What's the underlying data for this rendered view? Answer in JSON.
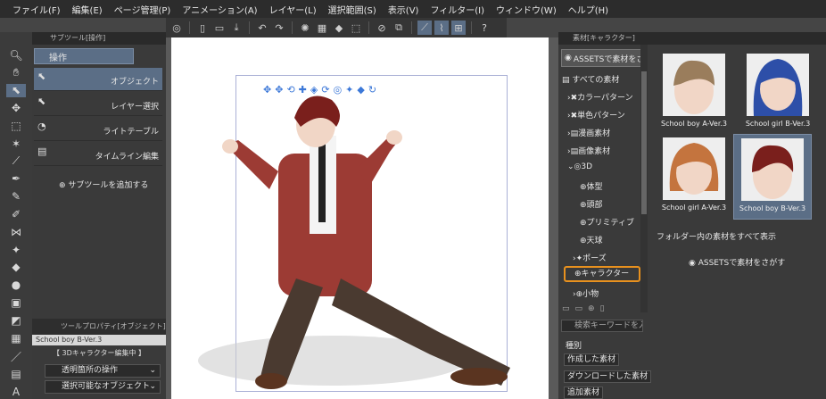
{
  "menubar": [
    "ファイル(F)",
    "編集(E)",
    "ページ管理(P)",
    "アニメーション(A)",
    "レイヤー(L)",
    "選択範囲(S)",
    "表示(V)",
    "フィルター(I)",
    "ウィンドウ(W)",
    "ヘルプ(H)"
  ],
  "subtool_panel": {
    "title": "サブツール[操作]",
    "group": "操作",
    "items": [
      "オブジェクト",
      "レイヤー選択",
      "ライトテーブル",
      "タイムライン編集"
    ],
    "add_label": "サブツールを追加する"
  },
  "tool_property": {
    "title": "ツールプロパティ[オブジェクト]",
    "head": "School boy B-Ver.3",
    "banner": "【 3Dキャラクター編集中 】",
    "dropdowns": [
      "透明箇所の操作",
      "選択可能なオブジェクト"
    ]
  },
  "material_panel": {
    "title": "素材[キャラクター]",
    "assets_button": "ASSETSで素材をさがす",
    "tree": [
      "すべての素材",
      "カラーパターン",
      "単色パターン",
      "漫画素材",
      "画像素材",
      "3D",
      "体型",
      "頭部",
      "プリミティブ",
      "天球",
      "ポーズ",
      "キャラクター",
      "小物"
    ],
    "search_placeholder": "検索キーワードを入...",
    "type_label": "種別",
    "type_buttons": [
      "作成した素材",
      "ダウンロードした素材",
      "追加素材"
    ],
    "thumbnails": [
      "School boy A-Ver.3",
      "School girl B-Ver.3",
      "School girl A-Ver.3",
      "School boy B-Ver.3"
    ],
    "show_all": "フォルダー内の素材をすべて表示",
    "assets_link": "ASSETSで素材をさがす"
  },
  "colors": {
    "accent": "#5b6e86",
    "highlight": "#e8911e"
  }
}
